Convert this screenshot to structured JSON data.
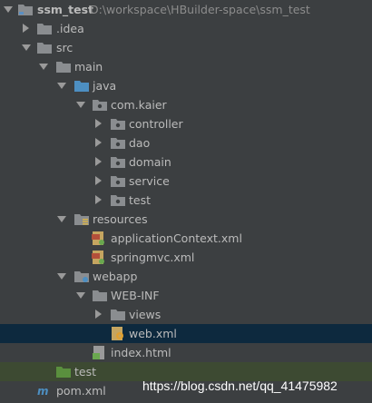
{
  "colors": {
    "background": "#3c3f41",
    "text": "#bbbbbb",
    "selection": "#0d293e",
    "test_highlight": "#3d4a32",
    "folder": "#8a8d90",
    "source_folder": "#4d8fc2",
    "test_folder": "#5a8f3e",
    "xml_file": "#c5a560"
  },
  "tree": {
    "project": {
      "name": "ssm_test",
      "path": "D:\\workspace\\HBuilder-space\\ssm_test",
      "icon": "folder-icon"
    },
    "idea": {
      "label": ".idea",
      "icon": "folder-icon"
    },
    "src": {
      "label": "src",
      "icon": "folder-icon"
    },
    "main": {
      "label": "main",
      "icon": "folder-icon"
    },
    "java": {
      "label": "java",
      "icon": "source-folder-icon"
    },
    "package": {
      "label": "com.kaier",
      "icon": "package-icon"
    },
    "controller": {
      "label": "controller",
      "icon": "package-icon"
    },
    "dao": {
      "label": "dao",
      "icon": "package-icon"
    },
    "domain": {
      "label": "domain",
      "icon": "package-icon"
    },
    "service": {
      "label": "service",
      "icon": "package-icon"
    },
    "test_pkg": {
      "label": "test",
      "icon": "package-icon"
    },
    "resources": {
      "label": "resources",
      "icon": "resources-folder-icon"
    },
    "app_context": {
      "label": "applicationContext.xml",
      "icon": "xml-file-icon"
    },
    "springmvc": {
      "label": "springmvc.xml",
      "icon": "xml-file-icon"
    },
    "webapp": {
      "label": "webapp",
      "icon": "folder-icon"
    },
    "web_inf": {
      "label": "WEB-INF",
      "icon": "folder-icon"
    },
    "views": {
      "label": "views",
      "icon": "folder-icon"
    },
    "web_xml": {
      "label": "web.xml",
      "icon": "web-xml-icon"
    },
    "index_html": {
      "label": "index.html",
      "icon": "html-file-icon"
    },
    "test_dir": {
      "label": "test",
      "icon": "test-folder-icon"
    },
    "pom": {
      "label": "pom.xml",
      "icon": "maven-icon"
    }
  },
  "watermark": "https://blog.csdn.net/qq_41475982"
}
